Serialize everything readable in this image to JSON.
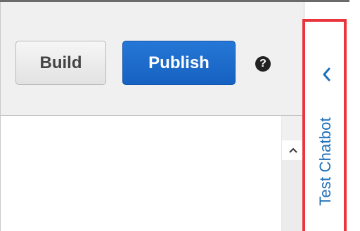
{
  "toolbar": {
    "build_label": "Build",
    "publish_label": "Publish",
    "help_icon": "question-circle-icon",
    "help_glyph": "?"
  },
  "content": {
    "scroll_up_icon": "chevron-up-icon"
  },
  "side_panel": {
    "label": "Test Chatbot",
    "expand_icon": "chevron-left-icon"
  },
  "colors": {
    "publish_blue": "#1f6fd0",
    "highlight_red": "#e8363c",
    "side_label_blue": "#1f6fb8"
  }
}
